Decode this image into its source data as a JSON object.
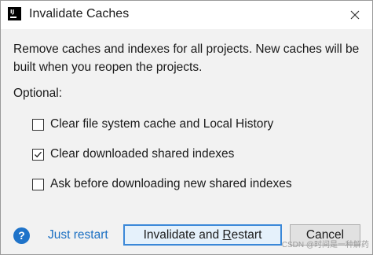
{
  "window": {
    "title": "Invalidate Caches",
    "app_icon": "intellij-app-icon",
    "close_icon": "close-icon"
  },
  "description": "Remove caches and indexes for all projects. New caches will be built when you reopen the projects.",
  "optional_label": "Optional:",
  "options": [
    {
      "label": "Clear file system cache and Local History",
      "checked": false
    },
    {
      "label": "Clear downloaded shared indexes",
      "checked": true
    },
    {
      "label": "Ask before downloading new shared indexes",
      "checked": false
    }
  ],
  "footer": {
    "help_icon": "help-icon",
    "help_glyph": "?",
    "just_restart_label": "Just restart",
    "invalidate_prefix": "Invalidate and ",
    "invalidate_mnemonic": "R",
    "invalidate_suffix": "estart",
    "cancel_label": "Cancel"
  },
  "watermark": "CSDN @时间是一种解药",
  "colors": {
    "accent": "#1f73c9",
    "link": "#1a6fc2",
    "primary_button_border": "#3b88d8",
    "primary_button_bg": "#e5f1fb"
  }
}
